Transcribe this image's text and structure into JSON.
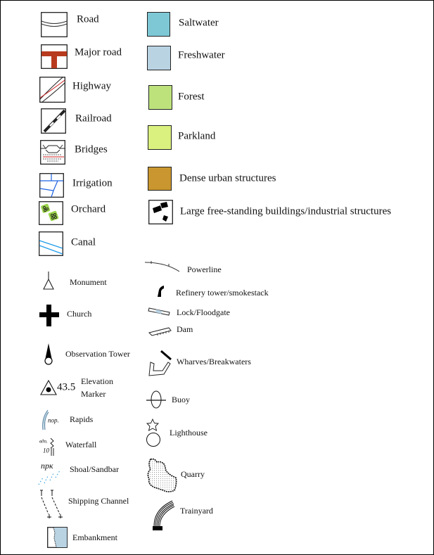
{
  "legend": {
    "line_features": [
      {
        "label": "Road",
        "icon": "road-icon"
      },
      {
        "label": "Major road",
        "icon": "major-road-icon"
      },
      {
        "label": "Highway",
        "icon": "highway-icon"
      },
      {
        "label": "Railroad",
        "icon": "railroad-icon"
      },
      {
        "label": "Bridges",
        "icon": "bridges-icon"
      },
      {
        "label": "Irrigation",
        "icon": "irrigation-icon"
      },
      {
        "label": "Orchard",
        "icon": "orchard-icon"
      },
      {
        "label": "Canal",
        "icon": "canal-icon"
      }
    ],
    "area_features": [
      {
        "label": "Saltwater",
        "color": "#7ec8d6"
      },
      {
        "label": "Freshwater",
        "color": "#b9d3e3"
      },
      {
        "label": "Forest",
        "color": "#bde27c"
      },
      {
        "label": "Parkland",
        "color": "#daf07f"
      },
      {
        "label": "Dense urban structures",
        "color": "#c9962f"
      },
      {
        "label": "Large free-standing buildings/industrial structures",
        "icon": "buildings-icon"
      }
    ],
    "point_features_left": [
      {
        "label": "Monument",
        "icon": "monument-icon"
      },
      {
        "label": "Church",
        "icon": "church-icon"
      },
      {
        "label": "Observation Tower",
        "icon": "observation-tower-icon"
      },
      {
        "label": "Elevation",
        "label2": "Marker",
        "value": "43.5",
        "icon": "elevation-marker-icon"
      },
      {
        "label": "Rapids",
        "icon_text": "пор.",
        "icon": "rapids-icon"
      },
      {
        "label": "Waterfall",
        "icon_text": "вдп.",
        "icon_text2": "10",
        "icon": "waterfall-icon"
      },
      {
        "label": "Shoal/Sandbar",
        "icon_text": "прк",
        "icon": "shoal-icon"
      },
      {
        "label": "Shipping Channel",
        "icon": "shipping-channel-icon"
      },
      {
        "label": "Embankment",
        "icon": "embankment-icon"
      }
    ],
    "point_features_right": [
      {
        "label": "Powerline",
        "icon": "powerline-icon"
      },
      {
        "label": "Refinery tower/smokestack",
        "icon": "smokestack-icon"
      },
      {
        "label": "Lock/Floodgate",
        "icon": "lock-icon"
      },
      {
        "label": "Dam",
        "icon": "dam-icon"
      },
      {
        "label": "Wharves/Breakwaters",
        "icon": "wharf-icon"
      },
      {
        "label": "Buoy",
        "icon": "buoy-icon"
      },
      {
        "label": "Lighthouse",
        "icon": "lighthouse-icon"
      },
      {
        "label": "Quarry",
        "icon": "quarry-icon"
      },
      {
        "label": "Trainyard",
        "icon": "trainyard-icon"
      }
    ]
  }
}
